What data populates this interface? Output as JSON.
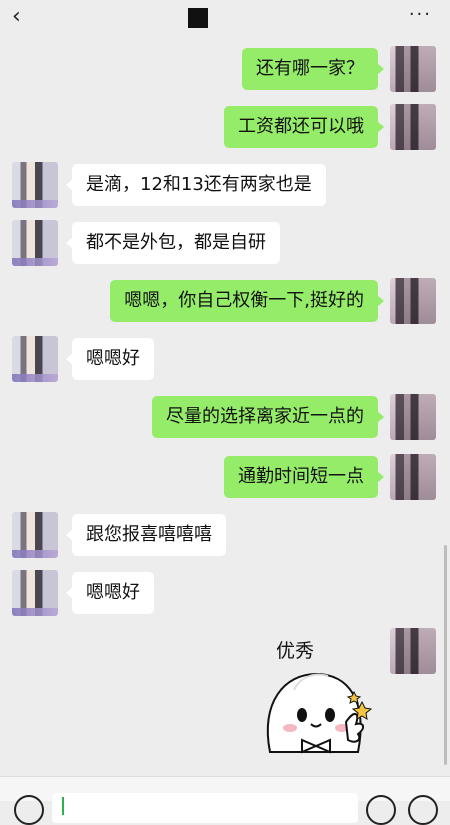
{
  "header": {
    "back_icon": "chevron-left-icon",
    "more_label": "···"
  },
  "messages": [
    {
      "side": "me",
      "text": "还有哪一家？"
    },
    {
      "side": "me",
      "text": "工资都还可以哦"
    },
    {
      "side": "other",
      "text": "是滴，12和13还有两家也是"
    },
    {
      "side": "other",
      "text": "都不是外包，都是自研"
    },
    {
      "side": "me",
      "text": "嗯嗯，你自己权衡一下,挺好的"
    },
    {
      "side": "other",
      "text": "嗯嗯好"
    },
    {
      "side": "me",
      "text": "尽量的选择离家近一点的"
    },
    {
      "side": "me",
      "text": "通勤时间短一点"
    },
    {
      "side": "other",
      "text": "跟您报喜嘻嘻嘻"
    },
    {
      "side": "other",
      "text": "嗯嗯好"
    }
  ],
  "sticker": {
    "side": "me",
    "caption": "优秀"
  },
  "colors": {
    "me_bubble": "#95ec69",
    "other_bubble": "#ffffff",
    "background": "#ededed"
  },
  "bottom_bar": {
    "voice_icon": "voice-icon",
    "emoji_icon": "emoji-icon",
    "plus_icon": "plus-icon"
  }
}
